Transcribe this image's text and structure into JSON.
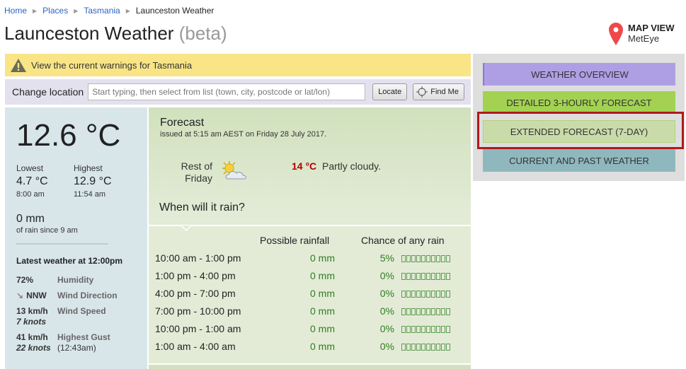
{
  "breadcrumb": {
    "items": [
      "Home",
      "Places",
      "Tasmania"
    ],
    "current": "Launceston Weather"
  },
  "page": {
    "title": "Launceston Weather",
    "title_suffix": "(beta)"
  },
  "map_view": {
    "line1": "MAP VIEW",
    "line2": "MetEye",
    "pin_color": "#f04848"
  },
  "warning": {
    "text": "View the current warnings for Tasmania",
    "background": "#f9e586"
  },
  "change_location": {
    "label": "Change location",
    "input_value": "",
    "placeholder": "Start typing, then select from list (town, city, postcode or lat/lon)",
    "locate_label": "Locate",
    "find_me_label": "Find Me"
  },
  "current": {
    "temperature": "12.6 °C",
    "lowest_label": "Lowest",
    "lowest_value": "4.7 °C",
    "lowest_time": "8:00 am",
    "highest_label": "Highest",
    "highest_value": "12.9 °C",
    "highest_time": "11:54 am",
    "rain_value": "0 mm",
    "rain_since": "of rain since 9 am",
    "latest_heading": "Latest weather at 12:00pm",
    "observations": [
      {
        "value": "72%",
        "value2": "",
        "label": "Humidity",
        "label2": ""
      },
      {
        "value": "NNW",
        "value2": "",
        "label": "Wind Direction",
        "label2": ""
      },
      {
        "value": "13 km/h",
        "value2": "7 knots",
        "label": "Wind Speed",
        "label2": ""
      },
      {
        "value": "41 km/h",
        "value2": "22 knots",
        "label": "Highest Gust",
        "label2": "(12:43am)"
      }
    ]
  },
  "forecast": {
    "title": "Forecast",
    "issued": "issued at 5:15 am AEST on Friday 28 July 2017.",
    "day_line1": "Rest of",
    "day_line2": "Friday",
    "icon": "partly-cloudy-icon",
    "max_temp": "14 °C",
    "description": "Partly cloudy.",
    "rain_question": "When will it rain?"
  },
  "rain_table": {
    "headers": {
      "rainfall": "Possible rainfall",
      "chance": "Chance of any rain"
    },
    "rows": [
      {
        "period": "10:00 am - 1:00 pm",
        "rainfall": "0 mm",
        "chance": "5%"
      },
      {
        "period": "1:00 pm - 4:00 pm",
        "rainfall": "0 mm",
        "chance": "0%"
      },
      {
        "period": "4:00 pm - 7:00 pm",
        "rainfall": "0 mm",
        "chance": "0%"
      },
      {
        "period": "7:00 pm - 10:00 pm",
        "rainfall": "0 mm",
        "chance": "0%"
      },
      {
        "period": "10:00 pm - 1:00 am",
        "rainfall": "0 mm",
        "chance": "0%"
      },
      {
        "period": "1:00 am - 4:00 am",
        "rainfall": "0 mm",
        "chance": "0%"
      }
    ]
  },
  "nav": {
    "items": [
      {
        "label": "WEATHER OVERVIEW",
        "color": "#ae9fe4"
      },
      {
        "label": "DETAILED 3-HOURLY FORECAST",
        "color": "#a3d252"
      },
      {
        "label": "EXTENDED FORECAST (7-DAY)",
        "color": "#cadbaa",
        "highlighted": true
      },
      {
        "label": "CURRENT AND PAST WEATHER",
        "color": "#8fb8be"
      }
    ]
  }
}
